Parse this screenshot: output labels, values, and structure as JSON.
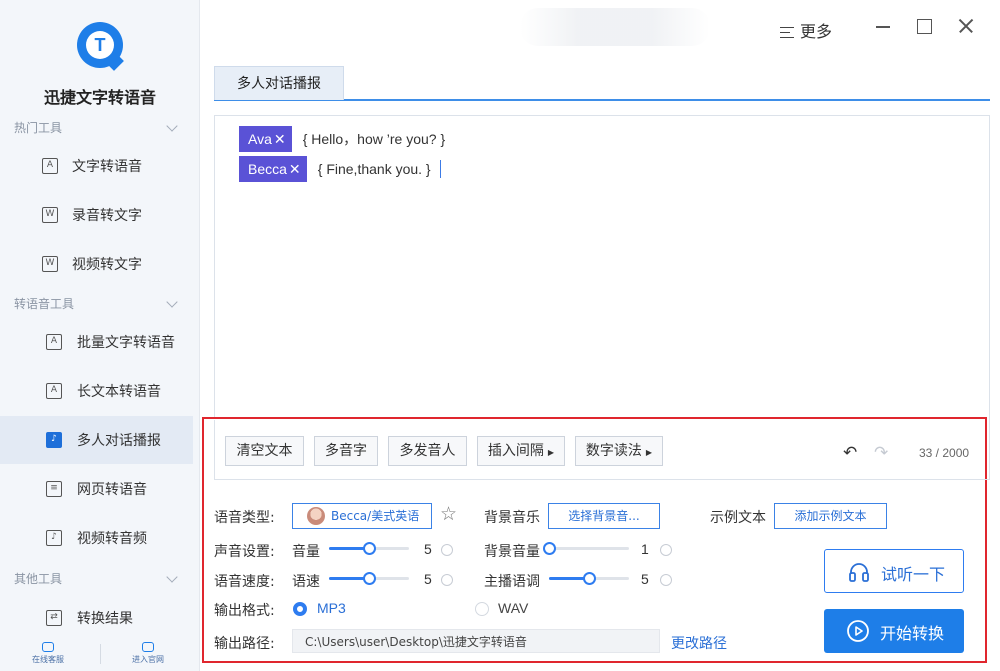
{
  "app": {
    "name": "迅捷文字转语音"
  },
  "titlebar": {
    "more_label": "更多"
  },
  "sidebar": {
    "groups": [
      {
        "label": "热门工具",
        "items": [
          {
            "label": "文字转语音",
            "icon": "text-to-speech-icon"
          },
          {
            "label": "录音转文字",
            "icon": "recording-to-text-icon"
          },
          {
            "label": "视频转文字",
            "icon": "video-to-text-icon"
          }
        ]
      },
      {
        "label": "转语音工具",
        "items": [
          {
            "label": "批量文字转语音",
            "icon": "batch-text-to-speech-icon"
          },
          {
            "label": "长文本转语音",
            "icon": "long-text-to-speech-icon"
          },
          {
            "label": "多人对话播报",
            "icon": "multi-person-dialog-icon",
            "active": true
          },
          {
            "label": "网页转语音",
            "icon": "webpage-to-speech-icon"
          },
          {
            "label": "视频转音频",
            "icon": "video-to-audio-icon"
          }
        ]
      },
      {
        "label": "其他工具",
        "items": [
          {
            "label": "转换结果",
            "icon": "conversion-results-icon"
          }
        ]
      }
    ],
    "bottom": {
      "online_service": "在线客服",
      "official_site": "进入官网"
    }
  },
  "tab": {
    "label": "多人对话播报"
  },
  "editor": {
    "lines": [
      {
        "speaker": "Ava",
        "remove": "✕",
        "text": "{ Hello，how  ’re you? }"
      },
      {
        "speaker": "Becca",
        "remove": "✕",
        "text": "{ Fine,thank you. }"
      }
    ]
  },
  "toolbar": {
    "clear": "清空文本",
    "polyphone": "多音字",
    "multi_speaker": "多发音人",
    "insert_pause": "插入间隔",
    "number_reading": "数字读法",
    "counter": "33 / 2000"
  },
  "settings": {
    "voice_type_label": "语音类型:",
    "voice_value": "Becca/美式英语",
    "bgm_label": "背景音乐",
    "bgm_button": "选择背景音...",
    "sample_label": "示例文本",
    "sample_button": "添加示例文本",
    "sound_label": "声音设置:",
    "volume_label": "音量",
    "volume_value": "5",
    "volume_fraction": 0.5,
    "bg_volume_label": "背景音量",
    "bg_volume_value": "1",
    "bg_volume_fraction": 0.0,
    "speed_row_label": "语音速度:",
    "speed_label": "语速",
    "speed_value": "5",
    "speed_fraction": 0.5,
    "pitch_label": "主播语调",
    "pitch_value": "5",
    "pitch_fraction": 0.5,
    "format_label": "输出格式:",
    "format_mp3": "MP3",
    "format_wav": "WAV",
    "format_selected": "MP3",
    "path_label": "输出路径:",
    "path_value": "C:\\Users\\user\\Desktop\\迅捷文字转语音",
    "change_path": "更改路径"
  },
  "actions": {
    "preview": "试听一下",
    "start": "开始转换"
  },
  "colors": {
    "accent": "#1e7ee8",
    "speaker_tag": "#5a52d6",
    "highlight_border": "#e0262e"
  }
}
